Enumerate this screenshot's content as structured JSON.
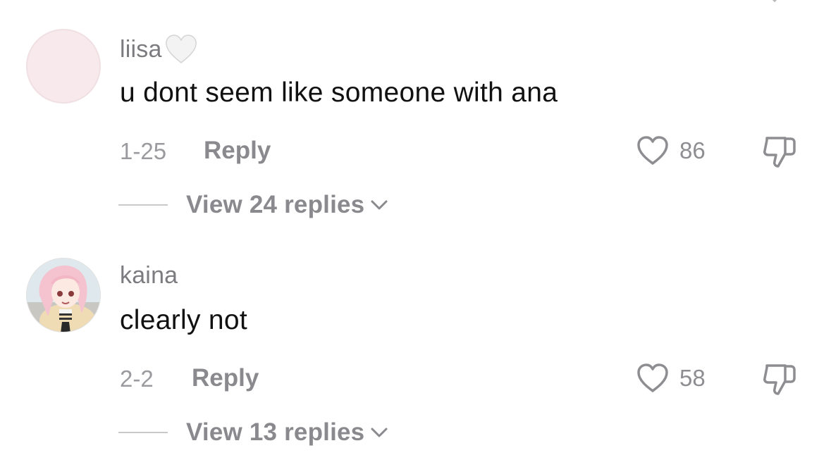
{
  "comments": [
    {
      "username": "liisa",
      "username_emoji": "white-heart-emoji",
      "text": "u dont seem like someone with ana",
      "date": "1-25",
      "reply_label": "Reply",
      "likes": "86",
      "view_replies_label": "View 24 replies"
    },
    {
      "username": "kaina",
      "text": "clearly not",
      "date": "2-2",
      "reply_label": "Reply",
      "likes": "58",
      "view_replies_label": "View 13 replies"
    }
  ],
  "colors": {
    "username": "#7c7c80",
    "body_text": "#111111",
    "meta": "#9b9b9f",
    "action": "#8a8a8e"
  }
}
